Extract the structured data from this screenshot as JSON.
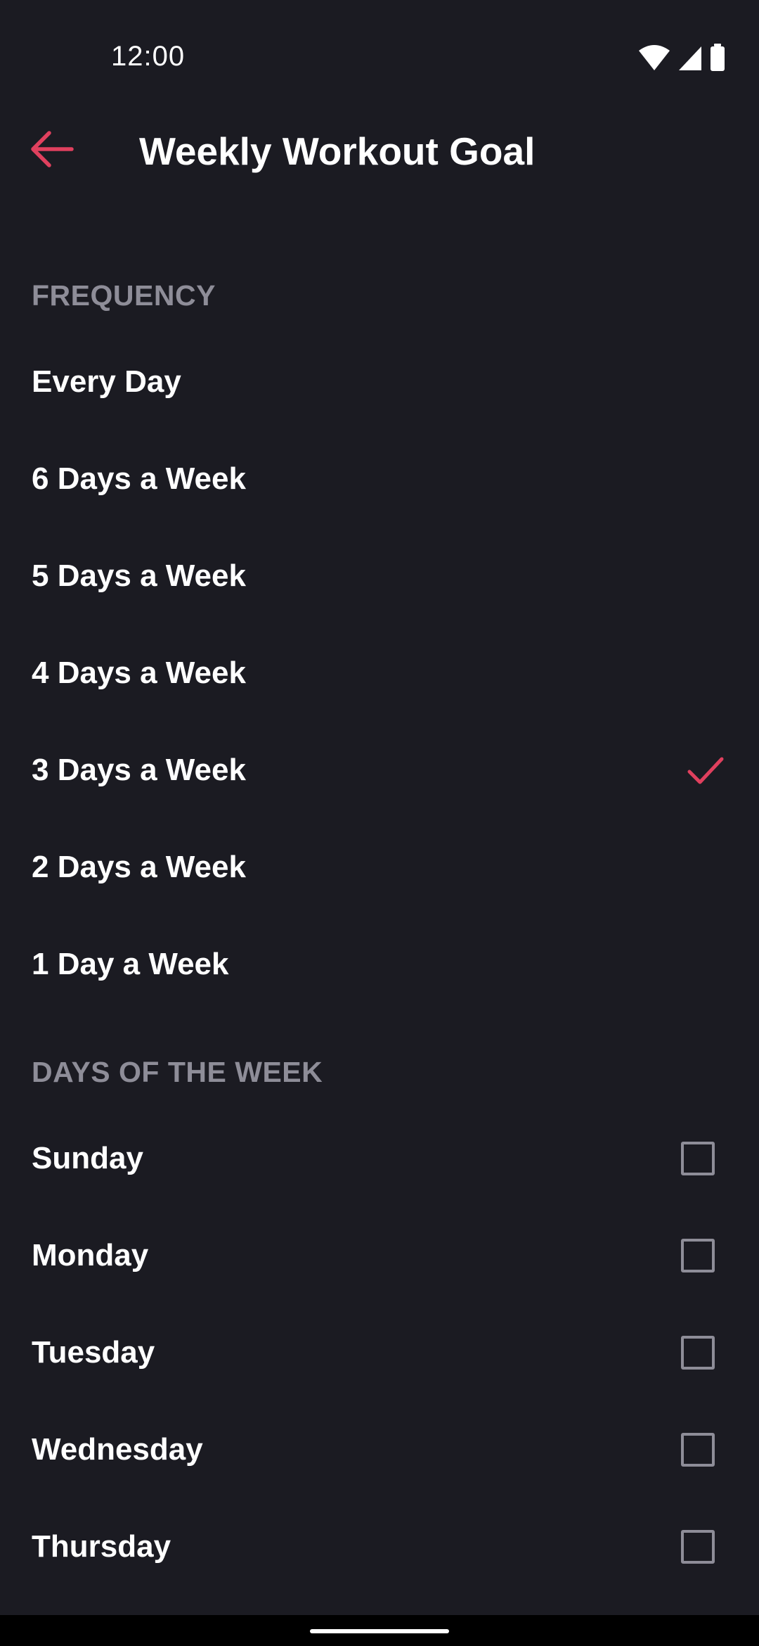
{
  "status_bar": {
    "time": "12:00",
    "icons": [
      "wifi-icon",
      "cellular-signal-icon",
      "battery-icon"
    ]
  },
  "app_bar": {
    "back_icon": "arrow-left-icon",
    "title": "Weekly Workout Goal"
  },
  "colors": {
    "background": "#1b1b22",
    "accent": "#e0405e",
    "secondary_text": "#8e8d98",
    "primary_text": "#ffffff"
  },
  "frequency": {
    "header": "FREQUENCY",
    "selected_index": 4,
    "options": [
      {
        "label": "Every Day",
        "selected": false
      },
      {
        "label": "6 Days a Week",
        "selected": false
      },
      {
        "label": "5 Days a Week",
        "selected": false
      },
      {
        "label": "4 Days a Week",
        "selected": false
      },
      {
        "label": "3 Days a Week",
        "selected": true
      },
      {
        "label": "2 Days a Week",
        "selected": false
      },
      {
        "label": "1 Day a Week",
        "selected": false
      }
    ]
  },
  "days_of_week": {
    "header": "DAYS OF THE WEEK",
    "days": [
      {
        "label": "Sunday",
        "checked": false
      },
      {
        "label": "Monday",
        "checked": false
      },
      {
        "label": "Tuesday",
        "checked": false
      },
      {
        "label": "Wednesday",
        "checked": false
      },
      {
        "label": "Thursday",
        "checked": false
      }
    ]
  }
}
